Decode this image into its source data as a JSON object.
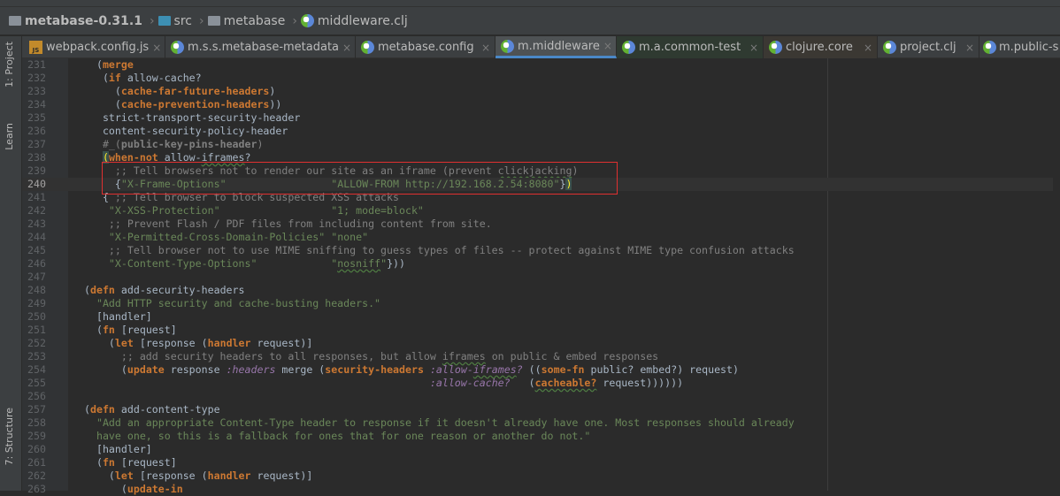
{
  "breadcrumb": [
    {
      "label": "metabase-0.31.1",
      "icon": "project-folder-icon"
    },
    {
      "label": "src",
      "icon": "source-folder-icon"
    },
    {
      "label": "metabase",
      "icon": "package-folder-icon"
    },
    {
      "label": "middleware.clj",
      "icon": "clojure-file-icon"
    }
  ],
  "tool_strip": {
    "project": "1: Project",
    "learn": "Learn",
    "structure": "7: Structure"
  },
  "tabs": [
    {
      "label": "webpack.config.js",
      "icon": "js-file-icon",
      "style": "normal"
    },
    {
      "label": "m.s.s.metabase-metadata",
      "icon": "clojure-file-icon",
      "style": "normal"
    },
    {
      "label": "metabase.config",
      "icon": "clojure-file-icon",
      "style": "normal"
    },
    {
      "label": "m.middleware",
      "icon": "clojure-file-icon",
      "style": "active"
    },
    {
      "label": "m.a.common-test",
      "icon": "clojure-file-icon",
      "style": "green"
    },
    {
      "label": "clojure.core",
      "icon": "clojure-file-icon",
      "style": "brown"
    },
    {
      "label": "project.clj",
      "icon": "clojure-file-icon",
      "style": "normal"
    },
    {
      "label": "m.public-s",
      "icon": "clojure-file-icon",
      "style": "normal"
    }
  ],
  "close_glyph": "×",
  "current_line": 240,
  "colors": {
    "keyword": "#cc7832",
    "string": "#6a8759",
    "comment": "#808080",
    "clj_keyword": "#9876aa",
    "text": "#a9b7c6",
    "highlight_box": "#e03030"
  },
  "code": [
    {
      "n": 231,
      "t": [
        [
          "p",
          "  ("
        ],
        [
          "k",
          "merge"
        ]
      ]
    },
    {
      "n": 232,
      "t": [
        [
          "p",
          "   ("
        ],
        [
          "k",
          "if"
        ],
        [
          "p",
          " allow-cache?"
        ]
      ]
    },
    {
      "n": 233,
      "t": [
        [
          "p",
          "     ("
        ],
        [
          "k",
          "cache-far-future-headers"
        ],
        [
          "p",
          ")"
        ]
      ]
    },
    {
      "n": 234,
      "t": [
        [
          "p",
          "     ("
        ],
        [
          "k",
          "cache-prevention-headers"
        ],
        [
          "p",
          "))"
        ]
      ]
    },
    {
      "n": 235,
      "t": [
        [
          "p",
          "   strict-transport-security-header"
        ]
      ]
    },
    {
      "n": 236,
      "t": [
        [
          "p",
          "   content-security-policy-header"
        ]
      ]
    },
    {
      "n": 237,
      "t": [
        [
          "p",
          "   "
        ],
        [
          "d",
          "#_("
        ],
        [
          "db",
          "public-key-pins-header"
        ],
        [
          "d",
          ")"
        ]
      ]
    },
    {
      "n": 238,
      "t": [
        [
          "p",
          "   "
        ],
        [
          "m",
          "("
        ],
        [
          "k",
          "when-not"
        ],
        [
          "p",
          " allow-"
        ],
        [
          "pw",
          "iframes"
        ],
        [
          "p",
          "?"
        ]
      ]
    },
    {
      "n": 239,
      "t": [
        [
          "c",
          "     ;; Tell browsers not to render our site as an iframe (prevent "
        ],
        [
          "cw",
          "clickjacking"
        ],
        [
          "c",
          ")"
        ]
      ]
    },
    {
      "n": 240,
      "t": [
        [
          "p",
          "     {"
        ],
        [
          "s",
          "\"X-Frame-Options\""
        ],
        [
          "p",
          "                 "
        ],
        [
          "s",
          "\"ALLOW-FROM http://192.168.2.54:8080\""
        ],
        [
          "p",
          "}"
        ],
        [
          "m",
          ")"
        ]
      ]
    },
    {
      "n": 241,
      "t": [
        [
          "p",
          "   { "
        ],
        [
          "c",
          ";; Tell browser to block suspected XSS attacks"
        ]
      ]
    },
    {
      "n": 242,
      "t": [
        [
          "p",
          "    "
        ],
        [
          "s",
          "\"X-XSS-Protection\""
        ],
        [
          "p",
          "                  "
        ],
        [
          "s",
          "\"1; mode=block\""
        ]
      ]
    },
    {
      "n": 243,
      "t": [
        [
          "c",
          "    ;; Prevent Flash / PDF files from including content from site."
        ]
      ]
    },
    {
      "n": 244,
      "t": [
        [
          "p",
          "    "
        ],
        [
          "s",
          "\"X-Permitted-Cross-Domain-Policies\""
        ],
        [
          "p",
          " "
        ],
        [
          "s",
          "\"none\""
        ]
      ]
    },
    {
      "n": 245,
      "t": [
        [
          "c",
          "    ;; Tell browser not to use MIME sniffing to guess types of files -- protect against MIME type confusion attacks"
        ]
      ]
    },
    {
      "n": 246,
      "t": [
        [
          "p",
          "    "
        ],
        [
          "s",
          "\"X-Content-Type-Options\""
        ],
        [
          "p",
          "            "
        ],
        [
          "s",
          "\""
        ],
        [
          "sw",
          "nosniff"
        ],
        [
          "s",
          "\""
        ],
        [
          "p",
          "}))"
        ]
      ]
    },
    {
      "n": 247,
      "t": []
    },
    {
      "n": 248,
      "t": [
        [
          "p",
          "("
        ],
        [
          "k",
          "defn"
        ],
        [
          "p",
          " add-security-headers"
        ]
      ]
    },
    {
      "n": 249,
      "t": [
        [
          "s",
          "  \"Add HTTP security and cache-busting headers.\""
        ]
      ]
    },
    {
      "n": 250,
      "t": [
        [
          "p",
          "  [handler]"
        ]
      ]
    },
    {
      "n": 251,
      "t": [
        [
          "p",
          "  ("
        ],
        [
          "k",
          "fn"
        ],
        [
          "p",
          " [request]"
        ]
      ]
    },
    {
      "n": 252,
      "t": [
        [
          "p",
          "    ("
        ],
        [
          "k",
          "let"
        ],
        [
          "p",
          " [response ("
        ],
        [
          "k",
          "handler"
        ],
        [
          "p",
          " request)]"
        ]
      ]
    },
    {
      "n": 253,
      "t": [
        [
          "c",
          "      ;; add security headers to all responses, but allow "
        ],
        [
          "cw",
          "iframes"
        ],
        [
          "c",
          " on public & embed responses"
        ]
      ]
    },
    {
      "n": 254,
      "t": [
        [
          "p",
          "      ("
        ],
        [
          "k",
          "update"
        ],
        [
          "p",
          " response "
        ],
        [
          "kw",
          ":headers"
        ],
        [
          "p",
          " merge ("
        ],
        [
          "k",
          "security-headers"
        ],
        [
          "p",
          " "
        ],
        [
          "kw",
          ":allow-"
        ],
        [
          "kww",
          "iframes"
        ],
        [
          "kw",
          "?"
        ],
        [
          "p",
          " (("
        ],
        [
          "k",
          "some-fn"
        ],
        [
          "p",
          " public? embed?) request)"
        ]
      ]
    },
    {
      "n": 255,
      "t": [
        [
          "p",
          "                                                        "
        ],
        [
          "kw",
          ":allow-cache?"
        ],
        [
          "p",
          "   ("
        ],
        [
          "kk",
          "cacheable?"
        ],
        [
          "p",
          " request))))))"
        ]
      ]
    },
    {
      "n": 256,
      "t": []
    },
    {
      "n": 257,
      "t": [
        [
          "p",
          "("
        ],
        [
          "k",
          "defn"
        ],
        [
          "p",
          " add-content-type"
        ]
      ]
    },
    {
      "n": 258,
      "t": [
        [
          "s",
          "  \"Add an appropriate Content-Type header to response if it doesn't already have one. Most responses should already"
        ]
      ]
    },
    {
      "n": 259,
      "t": [
        [
          "s",
          "  have one, so this is a fallback for ones that for one reason or another do not.\""
        ]
      ]
    },
    {
      "n": 260,
      "t": [
        [
          "p",
          "  [handler]"
        ]
      ]
    },
    {
      "n": 261,
      "t": [
        [
          "p",
          "  ("
        ],
        [
          "k",
          "fn"
        ],
        [
          "p",
          " [request]"
        ]
      ]
    },
    {
      "n": 262,
      "t": [
        [
          "p",
          "    ("
        ],
        [
          "k",
          "let"
        ],
        [
          "p",
          " [response ("
        ],
        [
          "k",
          "handler"
        ],
        [
          "p",
          " request)]"
        ]
      ]
    },
    {
      "n": 263,
      "t": [
        [
          "p",
          "      ("
        ],
        [
          "k",
          "update-in"
        ]
      ]
    }
  ]
}
